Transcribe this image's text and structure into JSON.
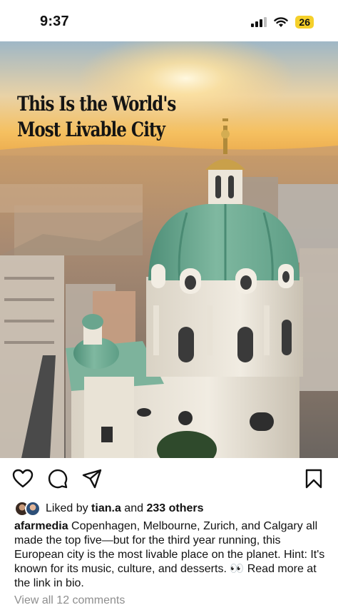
{
  "status_bar": {
    "time": "9:37",
    "battery": "26",
    "icons": [
      "cellular-signal-icon",
      "wifi-icon",
      "battery-icon"
    ]
  },
  "post": {
    "image": {
      "headline_line1": "This Is the World's",
      "headline_line2": "Most Livable City",
      "subject": "aerial view of a green-domed baroque church over a city at sunset"
    },
    "actions": {
      "icons": [
        "heart-icon",
        "comment-icon",
        "share-icon",
        "bookmark-icon"
      ]
    },
    "likes": {
      "prefix": "Liked by",
      "user": "tian.a",
      "middle": "and",
      "others": "233 others"
    },
    "caption": {
      "username": "afarmedia",
      "text": "Copenhagen, Melbourne, Zurich, and Calgary all made the top five—but for the third year running, this European city is the most livable place on the planet. Hint: It's known for its music, culture, and desserts. 👀 Read more at the link in bio."
    },
    "comments_link": "View all 12 comments"
  },
  "colors": {
    "dome_green": "#7fb8a0",
    "sky_gold": "#f5c35a",
    "battery_yellow": "#f5d02b",
    "muted_text": "#8e8e8e"
  }
}
